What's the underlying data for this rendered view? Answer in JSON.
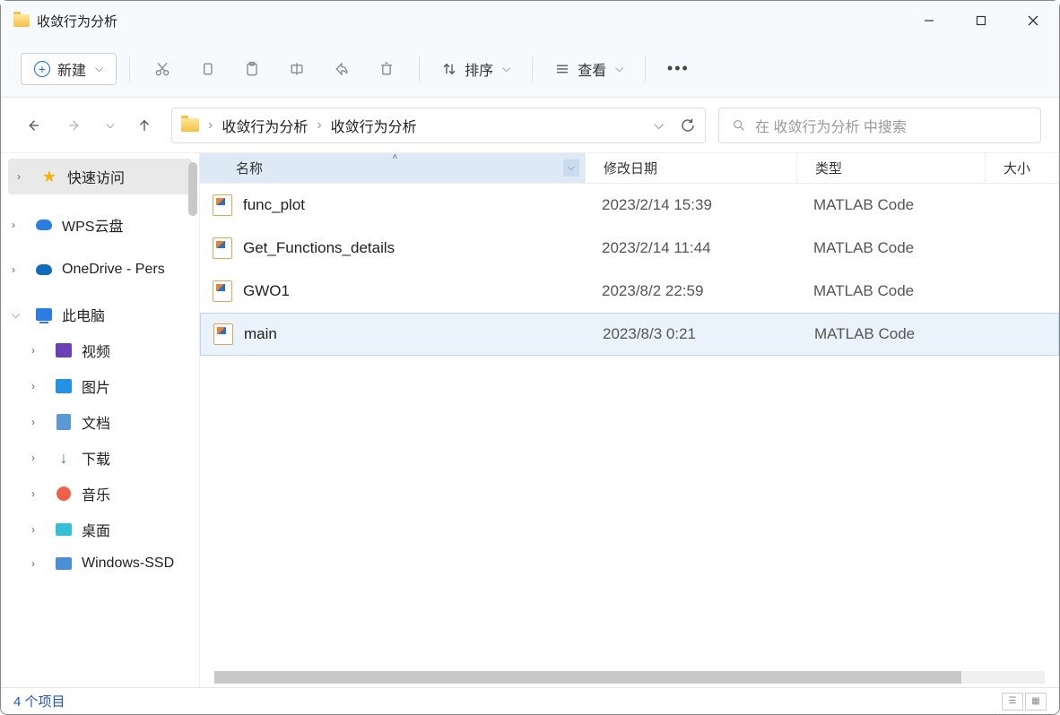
{
  "window": {
    "title": "收敛行为分析"
  },
  "toolbar": {
    "new_label": "新建",
    "sort_label": "排序",
    "view_label": "查看"
  },
  "breadcrumbs": [
    "收敛行为分析",
    "收敛行为分析"
  ],
  "search": {
    "placeholder": "在 收敛行为分析 中搜索"
  },
  "sidebar": {
    "quick_access": "快速访问",
    "wps": "WPS云盘",
    "onedrive": "OneDrive - Pers",
    "this_pc": "此电脑",
    "videos": "视频",
    "pictures": "图片",
    "documents": "文档",
    "downloads": "下载",
    "music": "音乐",
    "desktop": "桌面",
    "windows_ssd": "Windows-SSD"
  },
  "columns": {
    "name": "名称",
    "date": "修改日期",
    "type": "类型",
    "size": "大小"
  },
  "files": [
    {
      "name": "func_plot",
      "date": "2023/2/14 15:39",
      "type": "MATLAB Code"
    },
    {
      "name": "Get_Functions_details",
      "date": "2023/2/14 11:44",
      "type": "MATLAB Code"
    },
    {
      "name": "GWO1",
      "date": "2023/8/2 22:59",
      "type": "MATLAB Code"
    },
    {
      "name": "main",
      "date": "2023/8/3 0:21",
      "type": "MATLAB Code"
    }
  ],
  "selected_index": 3,
  "status": {
    "text": "4 个项目"
  }
}
